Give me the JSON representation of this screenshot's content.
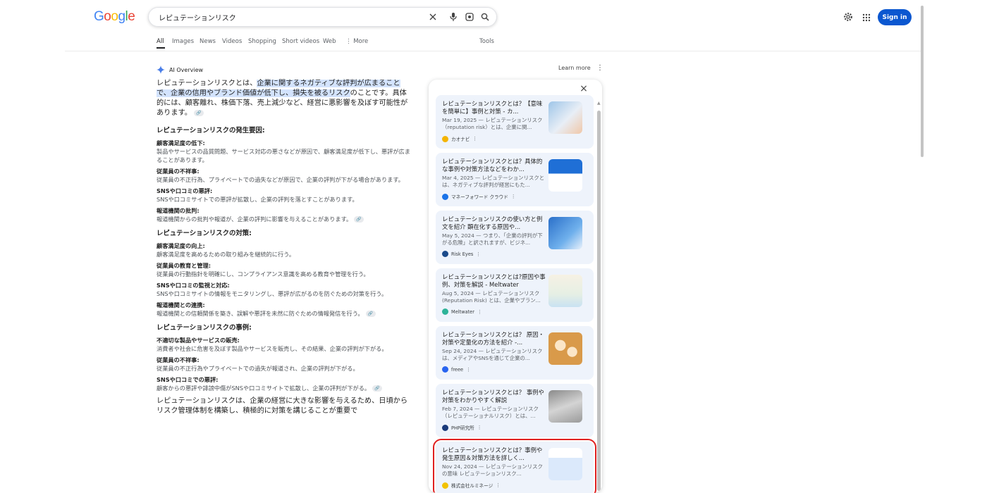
{
  "header": {
    "logo": "Google",
    "search_value": "レピュテーションリスク",
    "signin_label": "Sign in"
  },
  "tabs": [
    {
      "label": "All",
      "active": true
    },
    {
      "label": "Images"
    },
    {
      "label": "News"
    },
    {
      "label": "Videos"
    },
    {
      "label": "Shopping"
    },
    {
      "label": "Short videos"
    },
    {
      "label": "Web"
    },
    {
      "label": "More"
    }
  ],
  "tools_label": "Tools",
  "ai_overview": {
    "title": "AI Overview",
    "learn_more": "Learn more",
    "lead_pre": "レピュテーションリスクとは、",
    "lead_hl": "企業に関するネガティブな評判が広まることで、企業の信用やブランド価値が低下し、損失を被るリスク",
    "lead_post": "のことです。具体的には、顧客離れ、株価下落、売上減少など、経営に悪影響を及ぼす可能性があります。",
    "sections": [
      {
        "heading": "レピュテーションリスクの発生要因:",
        "items": [
          {
            "h": "顧客満足度の低下:",
            "d": "製品やサービスの品質問題、サービス対応の悪さなどが原因で、顧客満足度が低下し、悪評が広まることがあります。"
          },
          {
            "h": "従業員の不祥事:",
            "d": "従業員の不正行為、プライベートでの過失などが原因で、企業の評判が下がる場合があります。"
          },
          {
            "h": "SNSや口コミの悪評:",
            "d": "SNSや口コミサイトでの悪評が拡散し、企業の評判を落とすことがあります。"
          },
          {
            "h": "報道機関の批判:",
            "d": "報道機関からの批判や報道が、企業の評判に影響を与えることがあります。"
          }
        ]
      },
      {
        "heading": "レピュテーションリスクの対策:",
        "items": [
          {
            "h": "顧客満足度の向上:",
            "d": "顧客満足度を高めるための取り組みを継続的に行う。"
          },
          {
            "h": "従業員の教育と管理:",
            "d": "従業員の行動指針を明確にし、コンプライアンス意識を高める教育や管理を行う。"
          },
          {
            "h": "SNSや口コミの監視と対応:",
            "d": "SNSや口コミサイトの情報をモニタリングし、悪評が広がるのを防ぐための対策を行う。"
          },
          {
            "h": "報道機関との連携:",
            "d": "報道機関との信頼関係を築き、誤解や悪評を未然に防ぐための情報発信を行う。"
          }
        ]
      },
      {
        "heading": "レピュテーションリスクの事例:",
        "items": [
          {
            "h": "不適切な製品やサービスの販売:",
            "d": "消費者や社会に危害を及ぼす製品やサービスを販売し、その結果、企業の評判が下がる。"
          },
          {
            "h": "従業員の不祥事:",
            "d": "従業員の不正行為やプライベートでの過失が報道され、企業の評判が下がる。"
          },
          {
            "h": "SNSや口コミでの悪評:",
            "d": "顧客からの悪評や誹謗中傷がSNSや口コミサイトで拡散し、企業の評判が下がる。"
          }
        ]
      }
    ],
    "outro": "レピュテーションリスクは、企業の経営に大きな影響を与えるため、日頃からリスク管理体制を構築し、積極的に対策を講じることが重要で"
  },
  "sources": [
    {
      "title": "レピュテーションリスクとは？【意味を簡単に】事例と対策 - カ...",
      "snippet": "Mar 19, 2025 — レピュテーションリスク（reputation risk）とは、企業に関...",
      "source": "カオナビ",
      "favicon_color": "#f4b400"
    },
    {
      "title": "レピュテーションリスクとは？具体的な事例や対策方法などをわか...",
      "snippet": "Mar 4, 2025 — レピュテーションリスクとは、ネガティブな評判が経営にもた...",
      "source": "マネーフォワード クラウド",
      "favicon_color": "#1a73e8"
    },
    {
      "title": "レピュテーションリスクの使い方と例文を紹介 顕在化する原因や...",
      "snippet": "May 5, 2024 — つまり、「企業の評判が下がる危険」と訳されますが、ビジネ...",
      "source": "Risk Eyes",
      "favicon_color": "#1a4a8a"
    },
    {
      "title": "レピュテーションリスクとは?原因や事例、対策を解説 - Meltwater",
      "snippet": "Aug 5, 2024 — レピュテーションリスク(Reputation Risk) とは、企業やブラン...",
      "source": "Meltwater",
      "favicon_color": "#2eb398"
    },
    {
      "title": "レピュテーションリスクとは？ 原因・対策や定量化の方法を紹介 -...",
      "snippet": "Sep 24, 2024 — レピュテーションリスクは、メディアやSNSを通じて企業の...",
      "source": "freee",
      "favicon_color": "#2864f0"
    },
    {
      "title": "レピュテーションリスクとは？ 事例や対策をわかりやすく解説",
      "snippet": "Feb 7, 2024 — レピュテーションリスク（レピュテーショナルリスク）とは、...",
      "source": "PHP研究所",
      "favicon_color": "#1a3a7a"
    },
    {
      "title": "レピュテーションリスクとは？事例や発生原因＆対策方法を詳しく...",
      "snippet": "Nov 24, 2024 — レピュテーションリスクの意味 レピュテーションリスク...",
      "source": "株式会社ルミネージ",
      "favicon_color": "#f2c200"
    }
  ]
}
